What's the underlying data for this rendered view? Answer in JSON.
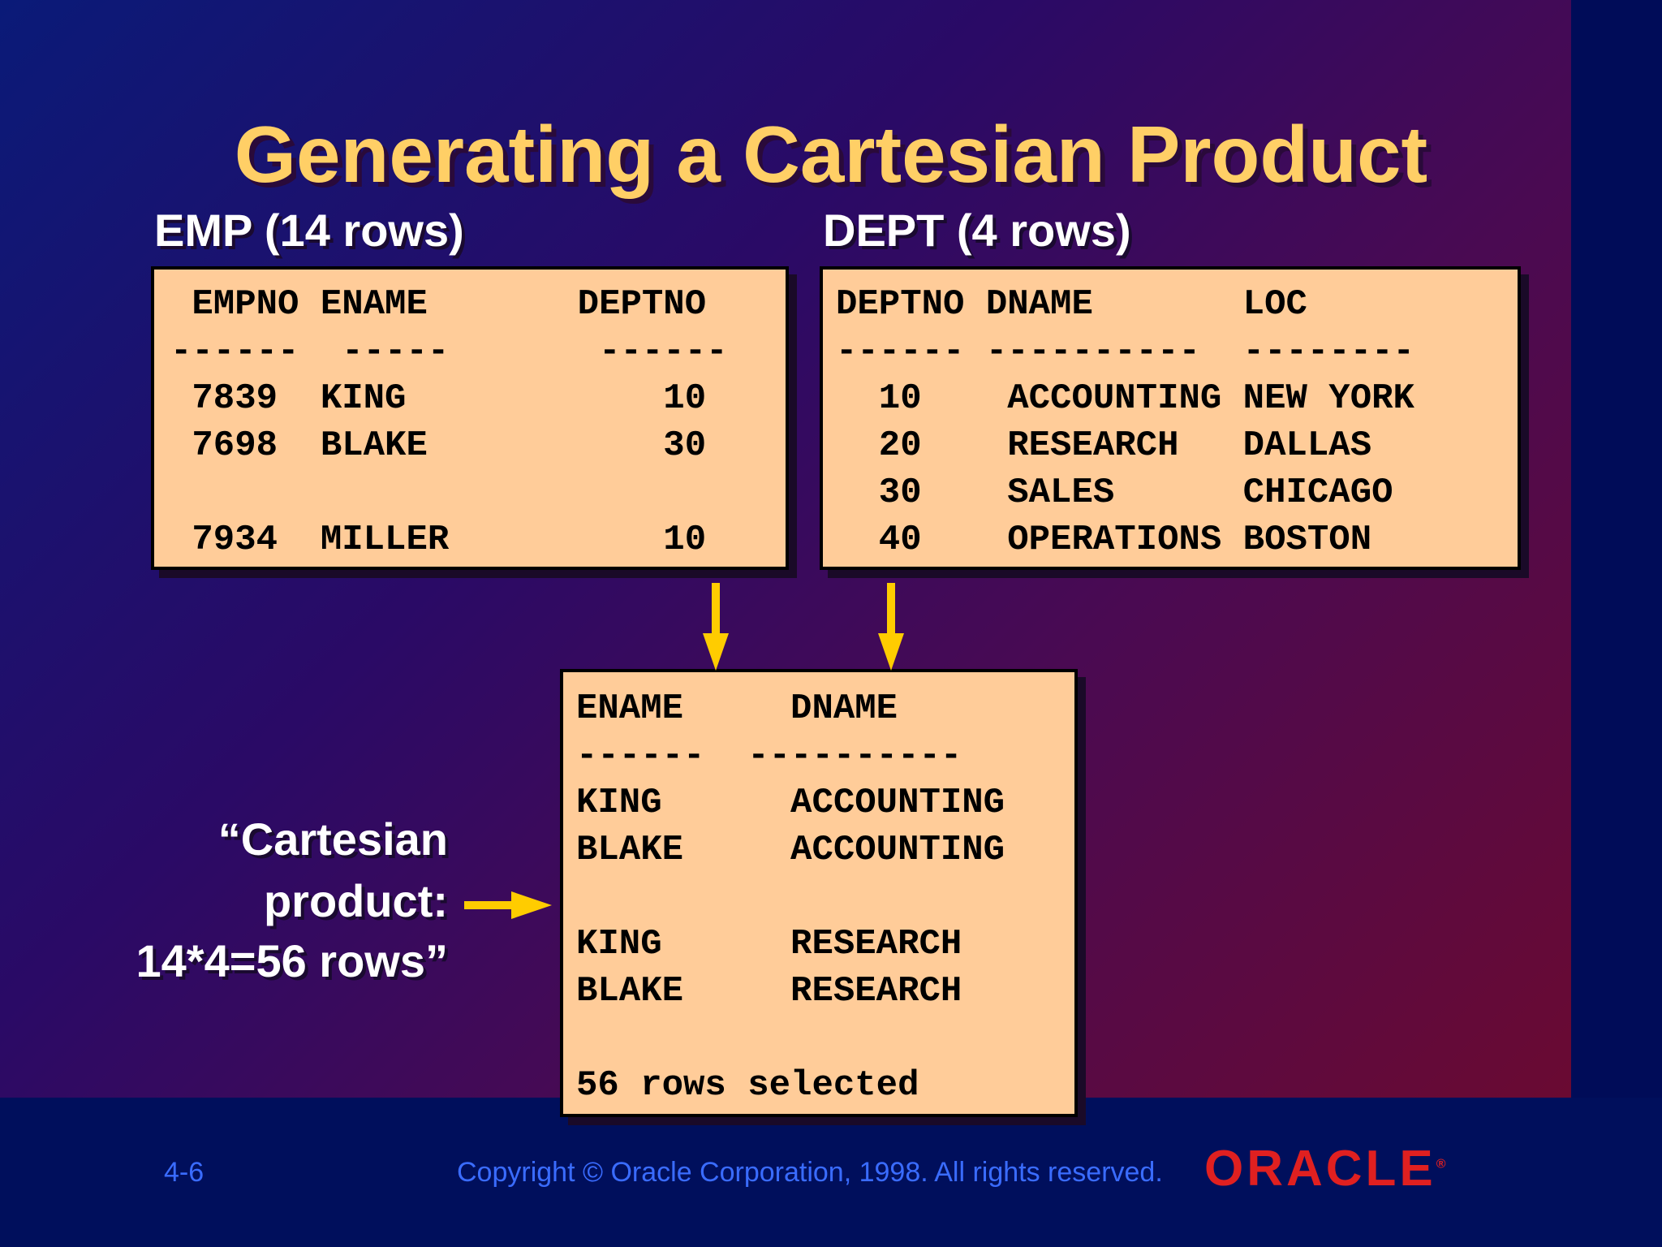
{
  "slide": {
    "title": "Generating a Cartesian Product",
    "emp_caption": "EMP (14 rows)",
    "dept_caption": "DEPT (4 rows)"
  },
  "emp_table": {
    "header": " EMPNO ENAME       DEPTNO",
    "divider": "------  -----       ------",
    "rows": [
      " 7839  KING            10",
      " 7698  BLAKE           30",
      "",
      " 7934  MILLER          10"
    ]
  },
  "dept_table": {
    "header": "DEPTNO DNAME       LOC",
    "divider": "------ ----------  --------",
    "rows": [
      "  10    ACCOUNTING NEW YORK",
      "  20    RESEARCH   DALLAS",
      "  30    SALES      CHICAGO",
      "  40    OPERATIONS BOSTON"
    ]
  },
  "result_table": {
    "header": "ENAME     DNAME",
    "divider": "------  ----------",
    "rows": [
      "KING      ACCOUNTING",
      "BLAKE     ACCOUNTING",
      "",
      "KING      RESEARCH",
      "BLAKE     RESEARCH",
      "",
      "56 rows selected"
    ]
  },
  "note": {
    "line1": "“Cartesian",
    "line2": "product:",
    "line3": "14*4=56 rows”"
  },
  "footer": {
    "page": "4-6",
    "copyright": "Copyright © Oracle Corporation, 1998. All rights reserved.",
    "logo": "ORACLE",
    "logo_mark": "®"
  },
  "colors": {
    "title": "#ffcf66",
    "box_fill": "#ffcc99",
    "arrow": "#ffcc00",
    "footer_text": "#3a6cff",
    "logo": "#e02020"
  }
}
